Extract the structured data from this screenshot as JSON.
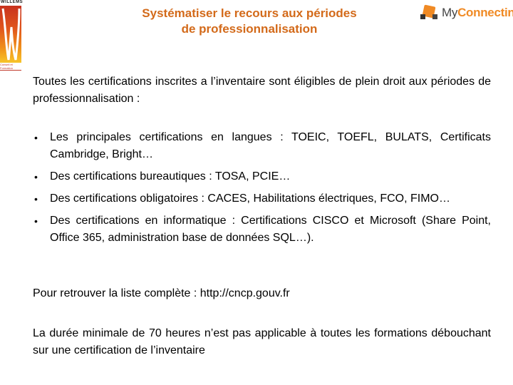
{
  "header": {
    "title_line1": "Systématiser le recours aux périodes",
    "title_line2": "de professionnalisation",
    "left_logo": {
      "brand": "WILLEMS",
      "subtitle": "Conseil et Formation",
      "icon": "willems-w-logo"
    },
    "right_logo": {
      "brand_prefix": "My",
      "brand_main": "Connecting",
      "icon": "cube-logo"
    }
  },
  "colors": {
    "title": "#d36a1a",
    "brand_orange": "#f08a24",
    "text": "#000000"
  },
  "body": {
    "intro": "Toutes les certifications inscrites a l’inventaire sont éligibles de plein droit aux périodes de professionnalisation :",
    "bullet_symbol": "•",
    "bullets": [
      {
        "text": "Les principales certifications en langues : TOEIC, TOEFL, BULATS, Certificats Cambridge, Bright…"
      },
      {
        "text": "Des certifications bureautiques : TOSA, PCIE…"
      },
      {
        "text": "Des certifications obligatoires :  CACES, Habilitations électriques, FCO, FIMO…"
      },
      {
        "text": "Des certifications en informatique : Certifications CISCO et Microsoft (Share Point, Office 365, administration base de données SQL…)."
      }
    ],
    "list_link_text": "Pour retrouver la liste complète : http://cncp.gouv.fr",
    "footer_note": "La durée minimale de 70 heures n’est pas applicable à toutes les formations débouchant sur une certification de l’inventaire"
  }
}
